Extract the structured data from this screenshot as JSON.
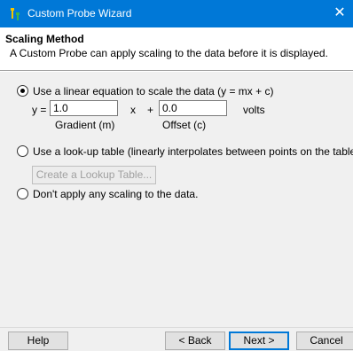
{
  "window": {
    "title": "Custom Probe Wizard",
    "close_glyph": "✕",
    "icon": "probe-wizard-icon",
    "accent_color": "#0078d7"
  },
  "header": {
    "title": "Scaling Method",
    "description": "A Custom Probe can apply scaling to the data before it is displayed."
  },
  "options": {
    "linear": {
      "label": "Use a linear equation to scale the data (y = mx + c)",
      "selected": true,
      "y_label": "y =",
      "gradient_value": "1.0",
      "x_label": "x",
      "plus_label": "+",
      "offset_value": "0.0",
      "unit_label": "volts",
      "gradient_caption": "Gradient (m)",
      "offset_caption": "Offset (c)"
    },
    "lookup": {
      "label": "Use a look-up table (linearly interpolates between points on the table).",
      "selected": false,
      "button_label": "Create a Lookup Table..."
    },
    "none": {
      "label": "Don't apply any scaling to the data.",
      "selected": false
    }
  },
  "footer": {
    "help_label": "Help",
    "back_label": "< Back",
    "next_label": "Next >",
    "cancel_label": "Cancel"
  }
}
